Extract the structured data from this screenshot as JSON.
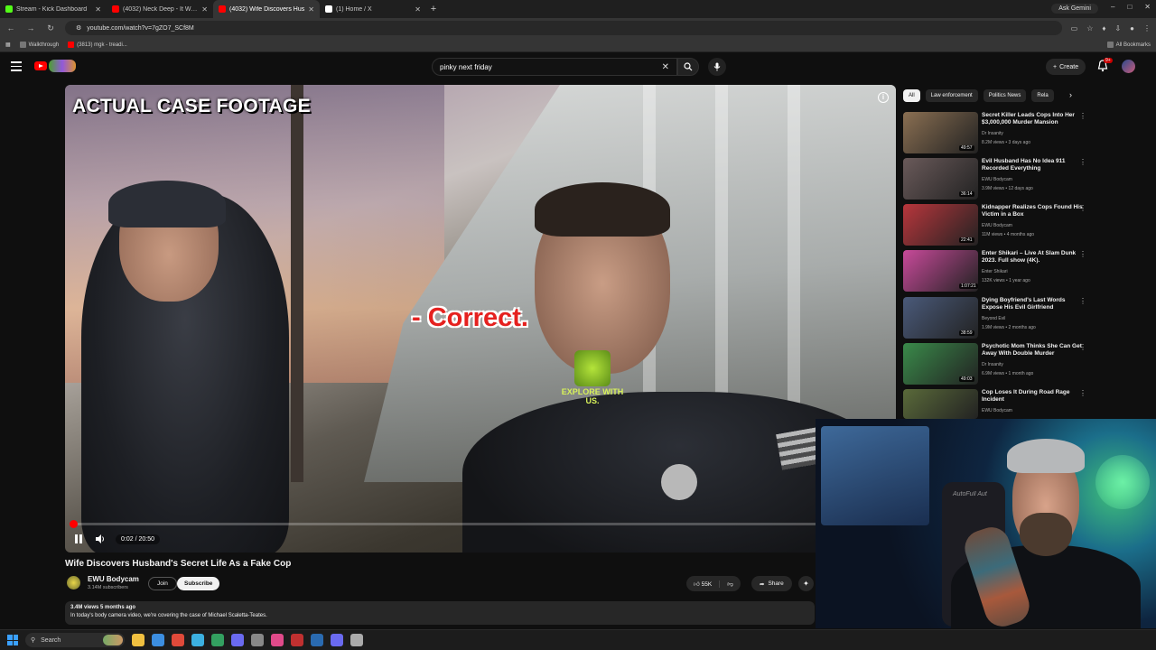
{
  "browser": {
    "tabs": [
      {
        "title": "Stream - Kick Dashboard",
        "color": "#53fc18",
        "active": false
      },
      {
        "title": "(4032) Neck Deep - It Won't Be",
        "color": "#ff0000",
        "active": false
      },
      {
        "title": "(4032) Wife Discovers Hus",
        "color": "#ff0000",
        "active": true
      },
      {
        "title": "(1) Home / X",
        "color": "#ffffff",
        "active": false
      }
    ],
    "ask_button": "Ask Gemini",
    "url": "youtube.com/watch?v=7gZO7_SCf8M",
    "bookmarks": [
      "Walkthrough",
      "(3813) mgk - treadi..."
    ],
    "all_bookmarks": "All Bookmarks"
  },
  "youtube": {
    "search_query": "pinky next friday",
    "create_label": "Create",
    "notif_badge": "9+"
  },
  "player": {
    "overlay_title": "ACTUAL CASE FOOTAGE",
    "caption": "- Correct.",
    "badge_text": "EXPLORE WITH US.",
    "time": "0:02 / 20:50",
    "progress_fraction": 0.0016
  },
  "video": {
    "title": "Wife Discovers Husband's Secret Life As a Fake Cop",
    "channel": "EWU Bodycam",
    "subscribers": "3.14M subscribers",
    "join_label": "Join",
    "subscribe_label": "Subscribe",
    "likes": "55K",
    "share_label": "Share",
    "views_age": "3.4M views  5 months ago",
    "description": "In today's body camera video, we're covering the case of Michael Scaletta-Teates."
  },
  "sidebar": {
    "chips": [
      "All",
      "Law enforcement",
      "Politics News",
      "Rela"
    ],
    "recommendations": [
      {
        "title": "Secret Killer Leads Cops Into Her $3,000,000 Murder Mansion",
        "channel": "Dr Insanity",
        "meta": "8.2M views • 3 days ago",
        "duration": "49:57",
        "thumb": "#8a6f52"
      },
      {
        "title": "Evil Husband Has No Idea 911 Recorded Everything",
        "channel": "EWU Bodycam",
        "meta": "3.9M views • 12 days ago",
        "duration": "36:14",
        "thumb": "#6a5a5a"
      },
      {
        "title": "Kidnapper Realizes Cops Found His Victim in a Box",
        "channel": "EWU Bodycam",
        "meta": "11M views • 4 months ago",
        "duration": "22:41",
        "thumb": "#b8363c"
      },
      {
        "title": "Enter Shikari – Live At Slam Dunk 2023. Full show (4K).",
        "channel": "Enter Shikari",
        "meta": "132K views • 1 year ago",
        "duration": "1:07:21",
        "thumb": "#c84a9a"
      },
      {
        "title": "Dying Boyfriend's Last Words Expose His Evil Girlfriend",
        "channel": "Beyond Evil",
        "meta": "1.9M views • 2 months ago",
        "duration": "38:59",
        "thumb": "#4a5a7a"
      },
      {
        "title": "Psychotic Mom Thinks She Can Get Away With Double Murder",
        "channel": "Dr Insanity",
        "meta": "6.9M views • 1 month ago",
        "duration": "49:03",
        "thumb": "#3a8a4a"
      },
      {
        "title": "Cop Loses It During Road Rage Incident",
        "channel": "EWU Bodycam",
        "meta": "",
        "duration": "",
        "thumb": "#5a6a3a"
      }
    ]
  },
  "webcam": {
    "wall_text": "AutoFull\nAut"
  },
  "taskbar": {
    "search_label": "Search",
    "apps": [
      "#f0c040",
      "#3c8ee0",
      "#e04a3a",
      "#3cb0e0",
      "#33a060",
      "#6a6af0",
      "#888888",
      "#e04a8a",
      "#c03030",
      "#2a6ab0",
      "#6a6af0",
      "#aaaaaa"
    ]
  }
}
